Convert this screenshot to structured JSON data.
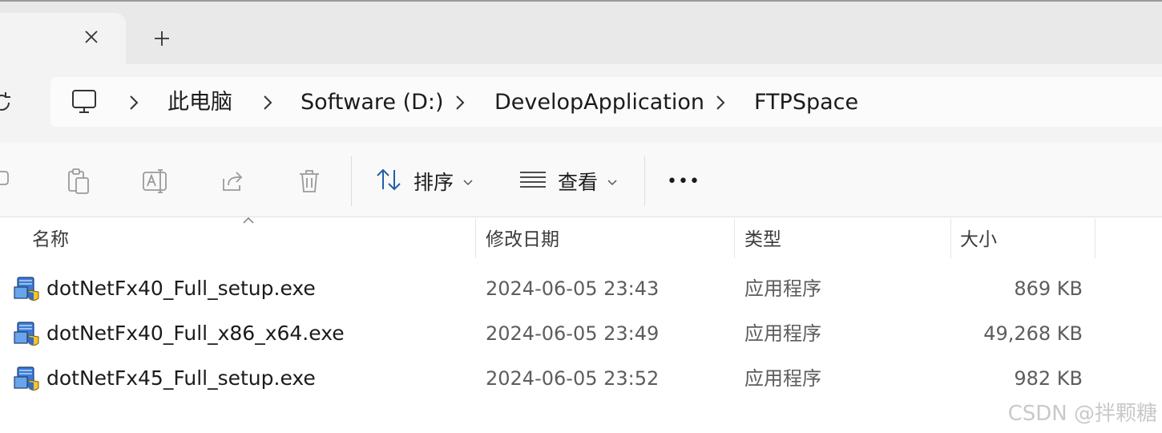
{
  "tabs": {
    "new_tab_label": "+"
  },
  "breadcrumb": {
    "items": [
      {
        "label": "此电脑"
      },
      {
        "label": "Software (D:)"
      },
      {
        "label": "DevelopApplication"
      },
      {
        "label": "FTPSpace"
      }
    ]
  },
  "toolbar": {
    "sort_label": "排序",
    "view_label": "查看",
    "more_label": "•••"
  },
  "columns": {
    "name": "名称",
    "date": "修改日期",
    "type": "类型",
    "size": "大小"
  },
  "files": [
    {
      "name": "dotNetFx40_Full_setup.exe",
      "date": "2024-06-05 23:43",
      "type": "应用程序",
      "size": "869 KB"
    },
    {
      "name": "dotNetFx40_Full_x86_x64.exe",
      "date": "2024-06-05 23:49",
      "type": "应用程序",
      "size": "49,268 KB"
    },
    {
      "name": "dotNetFx45_Full_setup.exe",
      "date": "2024-06-05 23:52",
      "type": "应用程序",
      "size": "982 KB"
    }
  ],
  "watermark": "CSDN @拌颗糖"
}
